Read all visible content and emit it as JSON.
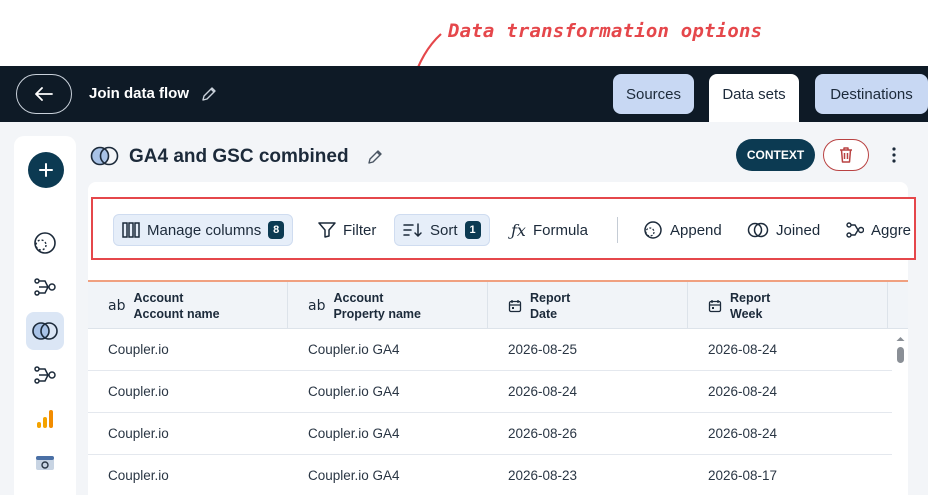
{
  "annotation": {
    "text": "Data transformation options"
  },
  "header": {
    "flow_title": "Join data flow",
    "tabs": [
      {
        "label": "Sources"
      },
      {
        "label": "Data sets"
      },
      {
        "label": "Destinations"
      }
    ]
  },
  "dataset": {
    "title": "GA4 and GSC combined",
    "context_label": "CONTEXT"
  },
  "toolbar": {
    "items": [
      {
        "label": "Manage columns",
        "count": "8",
        "icon": "columns-icon"
      },
      {
        "label": "Filter",
        "icon": "filter-icon"
      },
      {
        "label": "Sort",
        "count": "1",
        "icon": "sort-icon"
      },
      {
        "label": "Formula",
        "icon": "formula-icon"
      },
      {
        "label": "Append",
        "icon": "append-icon"
      },
      {
        "label": "Joined",
        "icon": "join-icon"
      },
      {
        "label": "Aggre",
        "icon": "aggregate-icon"
      }
    ]
  },
  "table": {
    "columns": [
      {
        "icon_text": "ab",
        "line1": "Account",
        "line2": "Account name"
      },
      {
        "icon_text": "ab",
        "line1": "Account",
        "line2": "Property name"
      },
      {
        "icon_text": "calendar",
        "line1": "Report",
        "line2": "Date"
      },
      {
        "icon_text": "calendar",
        "line1": "Report",
        "line2": "Week"
      }
    ],
    "rows": [
      [
        "Coupler.io",
        "Coupler.io GA4",
        "2026-08-25",
        "2026-08-24"
      ],
      [
        "Coupler.io",
        "Coupler.io GA4",
        "2026-08-24",
        "2026-08-24"
      ],
      [
        "Coupler.io",
        "Coupler.io GA4",
        "2026-08-26",
        "2026-08-24"
      ],
      [
        "Coupler.io",
        "Coupler.io GA4",
        "2026-08-23",
        "2026-08-17"
      ]
    ]
  },
  "colors": {
    "accent": "#e5474b",
    "dark": "#0e1a26",
    "navy": "#0c3a52",
    "tab": "#c8d8f3"
  }
}
